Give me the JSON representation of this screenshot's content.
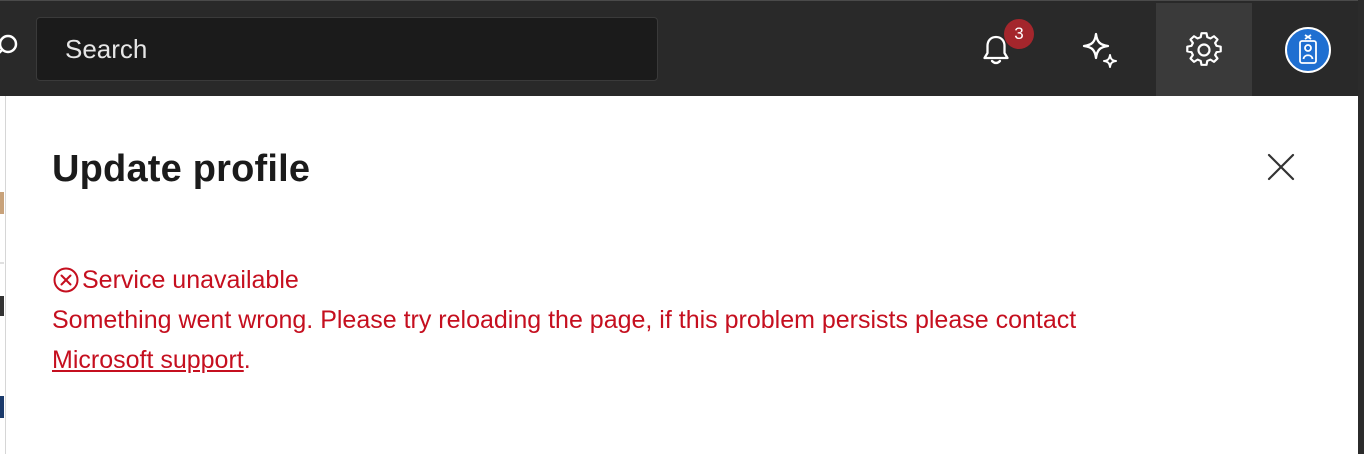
{
  "topbar": {
    "search": {
      "placeholder": "Search",
      "icon": "search-icon"
    },
    "notifications": {
      "icon": "bell-icon",
      "badge_count": "3",
      "badge_color": "#a4262c"
    },
    "copilot": {
      "icon": "sparkle-icon"
    },
    "settings": {
      "icon": "gear-icon"
    },
    "profile": {
      "icon": "avatar",
      "color": "#1f6fd1"
    },
    "background": "#292929"
  },
  "panel": {
    "title": "Update profile",
    "close_icon": "close-icon",
    "error": {
      "icon": "error-circle-icon",
      "heading": "Service unavailable",
      "message": "Something went wrong. Please try reloading the page, if this problem persists please contact",
      "link_text": "Microsoft support",
      "trailing": ".",
      "color": "#c50f1f"
    }
  }
}
